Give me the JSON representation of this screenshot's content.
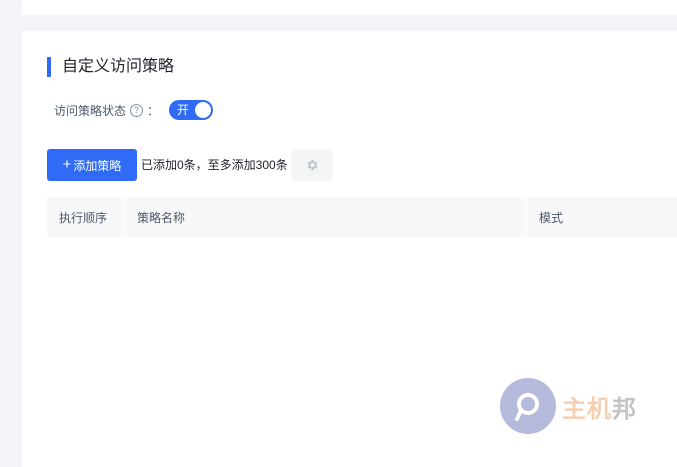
{
  "section": {
    "title": "自定义访问策略"
  },
  "status": {
    "label": "访问策略状态",
    "help_glyph": "?",
    "colon": "：",
    "switch_label": "开",
    "enabled": true
  },
  "toolbar": {
    "add_label": "添加策略",
    "add_icon": "plus-icon",
    "hint": "已添加0条，至多添加300条",
    "settings_icon": "gear-icon"
  },
  "table": {
    "columns": [
      "执行顺序",
      "策略名称",
      "模式"
    ],
    "rows": []
  },
  "watermark": {
    "text_main": "主机",
    "text_last": "邦"
  },
  "colors": {
    "accent": "#2f6bf6",
    "background": "#f3f4f7",
    "header_bg": "#f7f8fa"
  }
}
